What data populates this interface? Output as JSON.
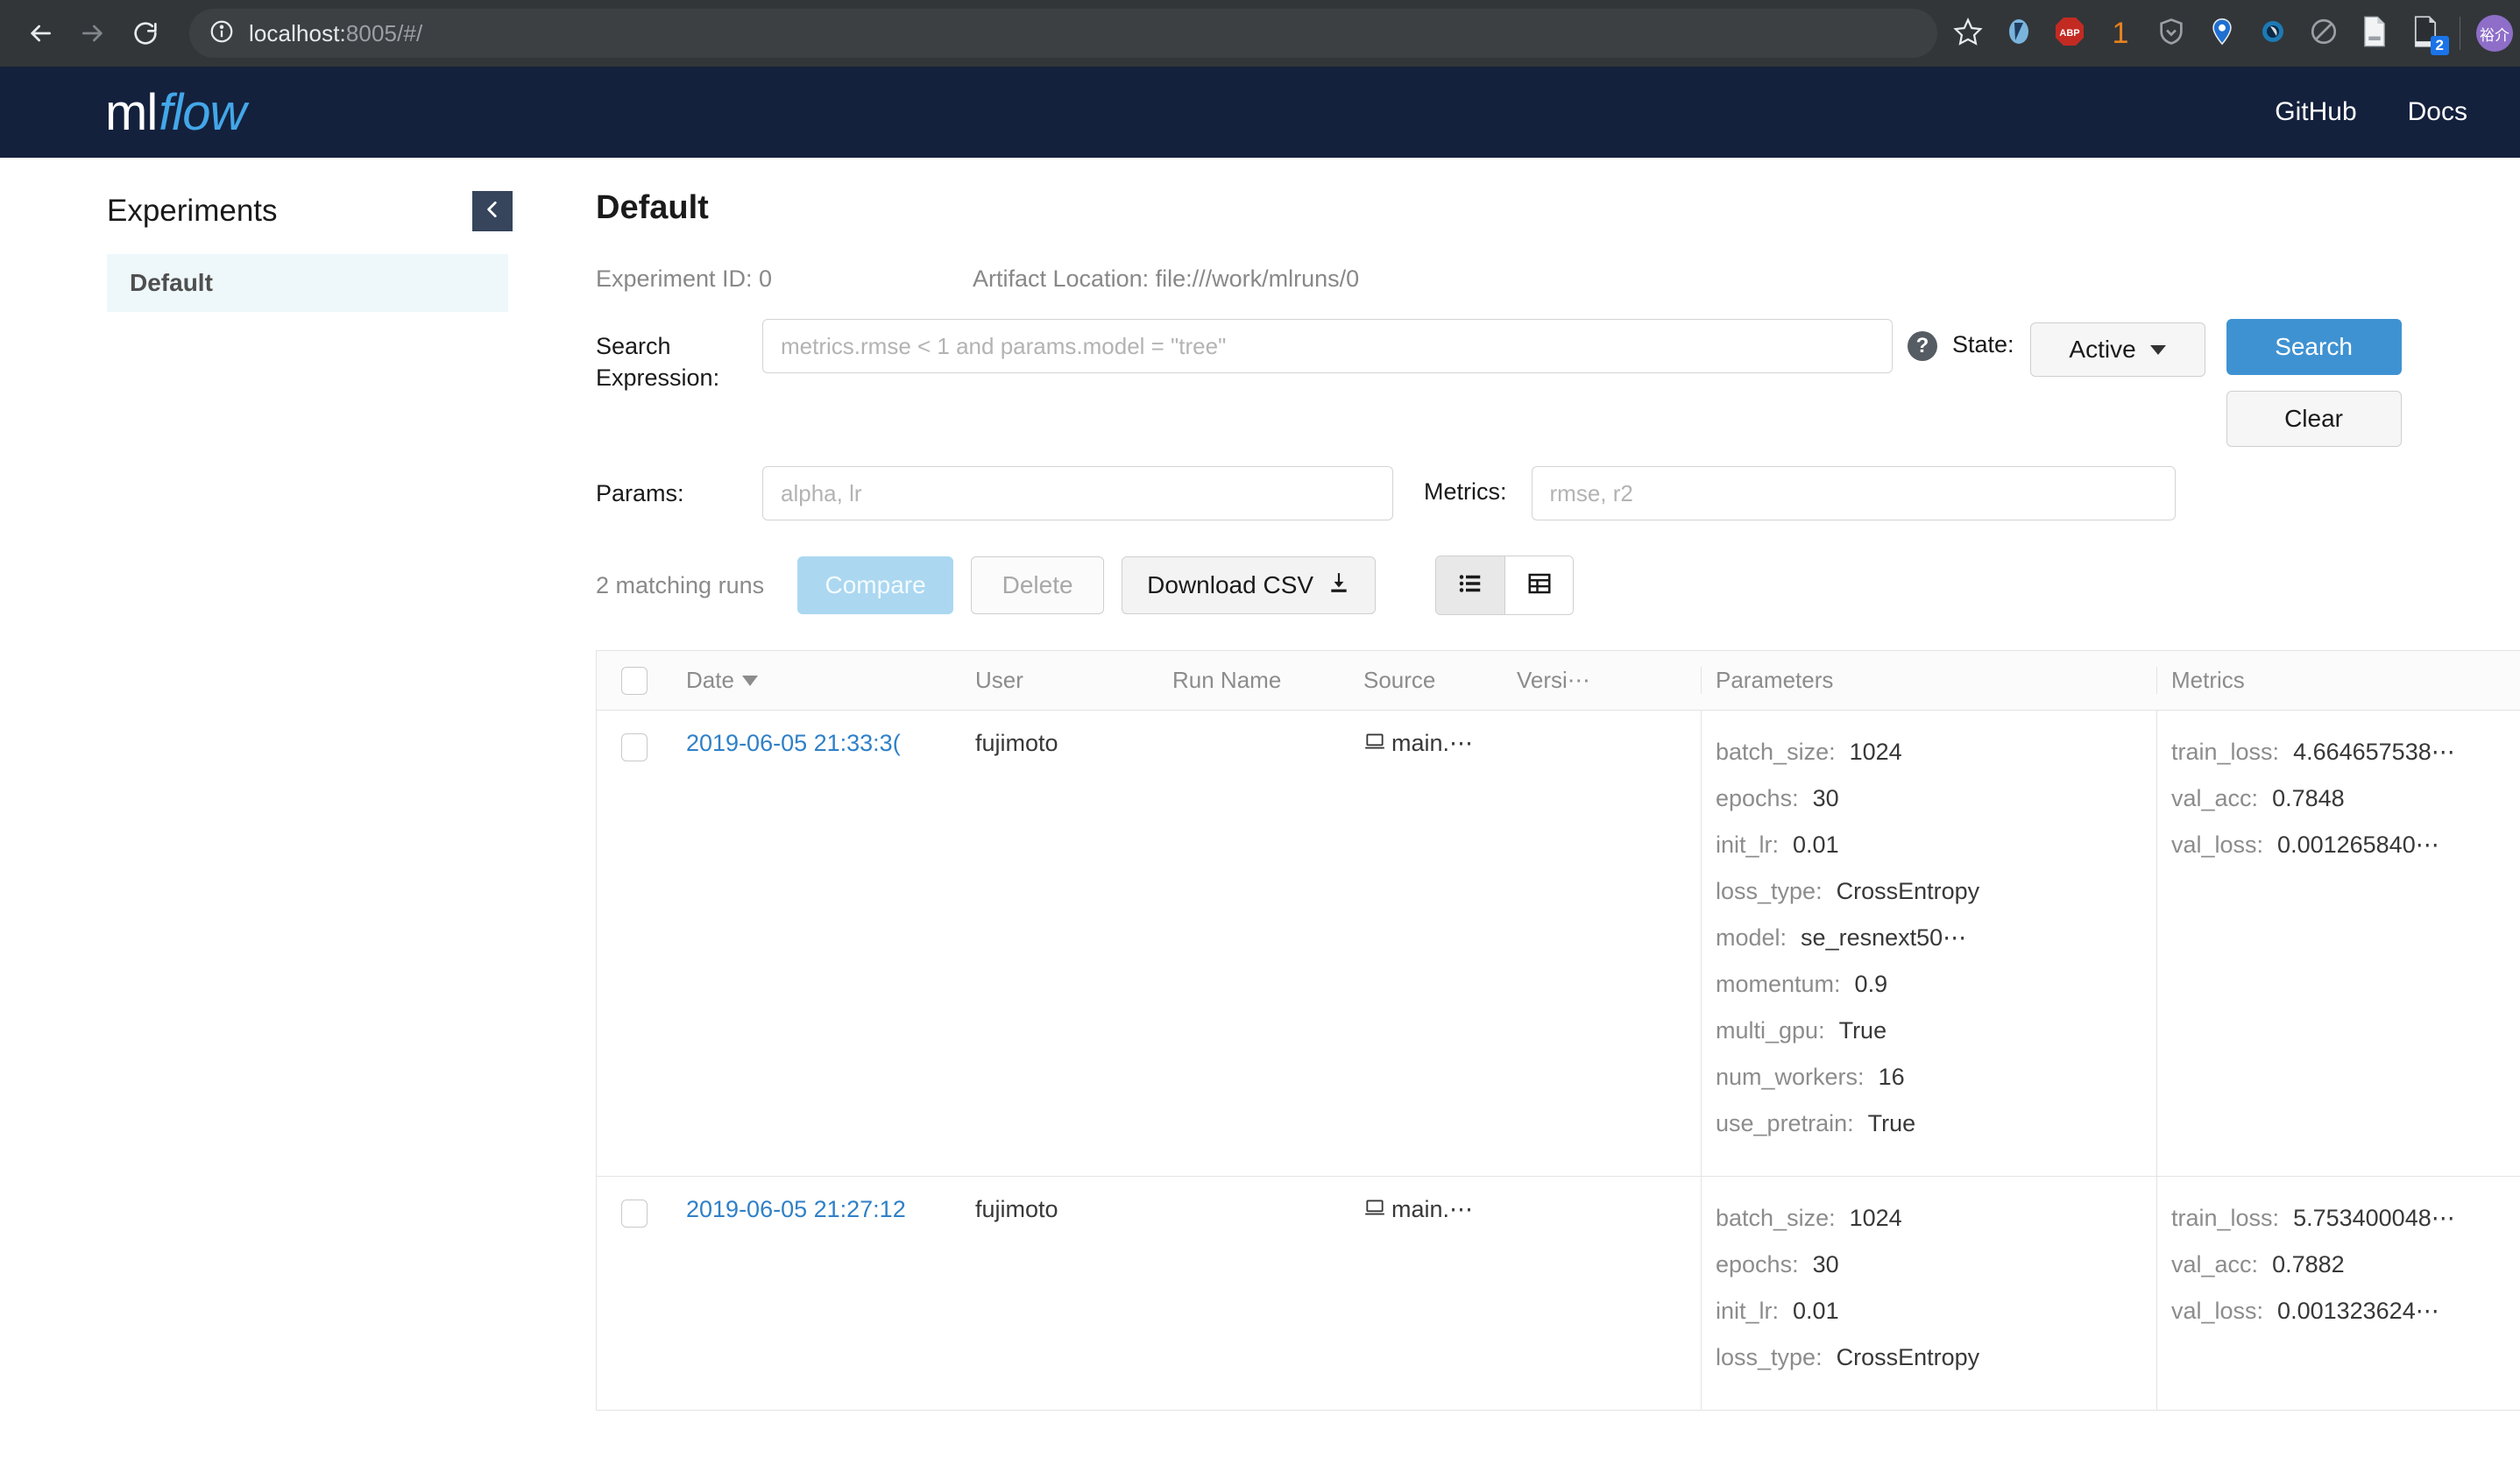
{
  "browser": {
    "back_icon": "back-arrow-icon",
    "forward_icon": "forward-arrow-icon",
    "reload_icon": "reload-icon",
    "info_icon": "info-icon",
    "url_text": "localhost:",
    "url_dim": "8005/#/",
    "star_icon": "bookmark-star-icon",
    "extensions": [
      {
        "name": "pocket-extension-icon",
        "label": ""
      },
      {
        "name": "adblock-plus-extension-icon",
        "label": "ABP"
      },
      {
        "name": "counter-extension-icon",
        "label": "1"
      },
      {
        "name": "shield-extension-icon",
        "label": ""
      },
      {
        "name": "location-pin-extension-icon",
        "label": ""
      },
      {
        "name": "eye-extension-icon",
        "label": ""
      },
      {
        "name": "block-extension-icon",
        "label": ""
      },
      {
        "name": "document-extension-icon",
        "label": ""
      },
      {
        "name": "notes-extension-icon",
        "label": "2"
      }
    ],
    "avatar_label": "裕介",
    "menu_icon": "kebab-menu-icon"
  },
  "navbar": {
    "logo_ml": "ml",
    "logo_flow": "flow",
    "links": [
      {
        "label": "GitHub"
      },
      {
        "label": "Docs"
      }
    ]
  },
  "sidebar": {
    "title": "Experiments",
    "collapse_icon": "chevron-left-icon",
    "items": [
      {
        "label": "Default"
      }
    ]
  },
  "experiment": {
    "name": "Default",
    "id_label": "Experiment ID: 0",
    "artifact_label": "Artifact Location: file:///work/mlruns/0"
  },
  "search_form": {
    "search_expression_label": "Search Expression:",
    "search_expression_placeholder": "metrics.rmse < 1 and params.model = \"tree\"",
    "search_expression_value": "",
    "help_icon": "help-question-icon",
    "state_label": "State:",
    "state_value": "Active",
    "params_label": "Params:",
    "params_placeholder": "alpha, lr",
    "params_value": "",
    "metrics_label": "Metrics:",
    "metrics_placeholder": "rmse, r2",
    "metrics_value": "",
    "search_button": "Search",
    "clear_button": "Clear"
  },
  "toolbar": {
    "runs_count": "2 matching runs",
    "compare_label": "Compare",
    "delete_label": "Delete",
    "download_csv_label": "Download CSV",
    "download_icon": "download-icon",
    "list_view_icon": "list-view-icon",
    "grid_view_icon": "grid-view-icon"
  },
  "table": {
    "headers": {
      "date": "Date",
      "user": "User",
      "run_name": "Run Name",
      "source": "Source",
      "version": "Versi⋯",
      "parameters": "Parameters",
      "metrics": "Metrics"
    },
    "sort_icon": "sort-descending-icon",
    "rows": [
      {
        "date": "2019-06-05 21:33:3(",
        "user": "fujimoto",
        "run_name": "",
        "source_icon": "laptop-icon",
        "source": "main.⋯",
        "version": "",
        "parameters": [
          {
            "key": "batch_size:",
            "value": "1024"
          },
          {
            "key": "epochs:",
            "value": "30"
          },
          {
            "key": "init_lr:",
            "value": "0.01"
          },
          {
            "key": "loss_type:",
            "value": "CrossEntropy"
          },
          {
            "key": "model:",
            "value": "se_resnext50⋯"
          },
          {
            "key": "momentum:",
            "value": "0.9"
          },
          {
            "key": "multi_gpu:",
            "value": "True"
          },
          {
            "key": "num_workers:",
            "value": "16"
          },
          {
            "key": "use_pretrain:",
            "value": "True"
          }
        ],
        "metrics": [
          {
            "key": "train_loss:",
            "value": "4.664657538⋯"
          },
          {
            "key": "val_acc:",
            "value": "0.7848"
          },
          {
            "key": "val_loss:",
            "value": "0.001265840⋯"
          }
        ]
      },
      {
        "date": "2019-06-05 21:27:12",
        "user": "fujimoto",
        "run_name": "",
        "source_icon": "laptop-icon",
        "source": "main.⋯",
        "version": "",
        "parameters": [
          {
            "key": "batch_size:",
            "value": "1024"
          },
          {
            "key": "epochs:",
            "value": "30"
          },
          {
            "key": "init_lr:",
            "value": "0.01"
          },
          {
            "key": "loss_type:",
            "value": "CrossEntropy"
          }
        ],
        "metrics": [
          {
            "key": "train_loss:",
            "value": "5.753400048⋯"
          },
          {
            "key": "val_acc:",
            "value": "0.7882"
          },
          {
            "key": "val_loss:",
            "value": "0.001323624⋯"
          }
        ]
      }
    ]
  },
  "colors": {
    "navbar_bg": "#14213d",
    "logo_accent": "#43a7e8",
    "primary_button": "#3f92d2",
    "link": "#2f80c7",
    "sidebar_selected_bg": "#eef7fa",
    "compare_disabled": "#abd7f0",
    "browser_chrome": "#323639"
  }
}
